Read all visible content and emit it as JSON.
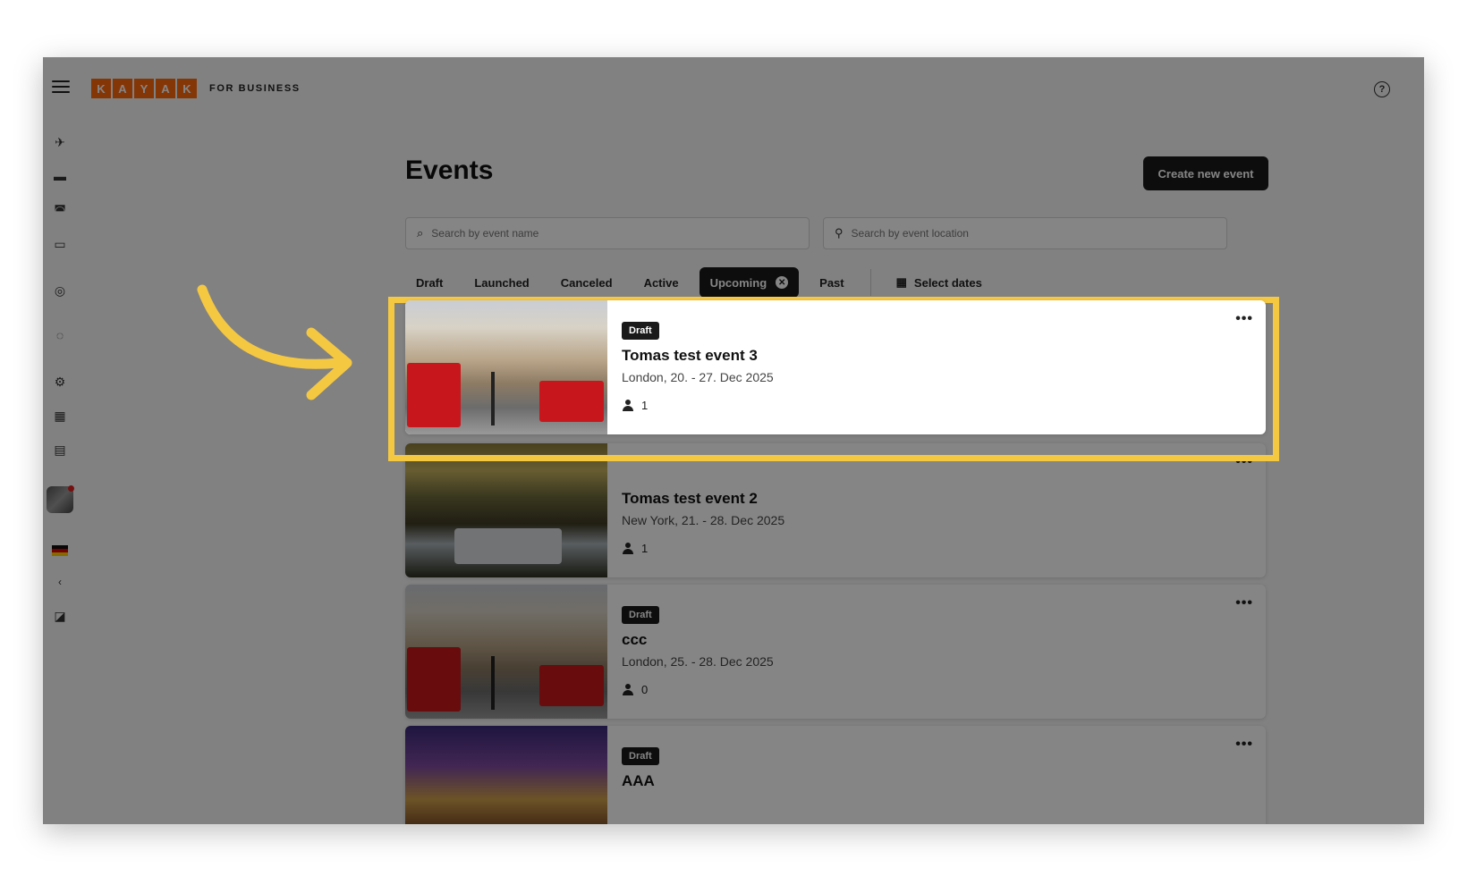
{
  "app": {
    "logo_letters": [
      "K",
      "A",
      "Y",
      "A",
      "K"
    ],
    "logo_sub": "FOR BUSINESS",
    "help_icon": "?"
  },
  "sidebar": {
    "icons": [
      "flight-icon",
      "hotel-icon",
      "car-icon",
      "train-icon",
      "target-icon",
      "support-icon",
      "settings-icon",
      "calendar-icon",
      "report-icon"
    ],
    "collapse_glyph": "‹"
  },
  "page": {
    "title": "Events",
    "create_button": "Create new event"
  },
  "search": {
    "name_placeholder": "Search by event name",
    "location_placeholder": "Search by event location"
  },
  "tabs": [
    {
      "label": "Draft",
      "active": false
    },
    {
      "label": "Launched",
      "active": false
    },
    {
      "label": "Canceled",
      "active": false
    },
    {
      "label": "Active",
      "active": false
    },
    {
      "label": "Upcoming",
      "active": true
    },
    {
      "label": "Past",
      "active": false
    }
  ],
  "date_filter": "Select dates",
  "events": [
    {
      "badge": "Draft",
      "title": "Tomas test event 3",
      "subtitle": "London, 20. - 27. Dec 2025",
      "people": "1"
    },
    {
      "badge": "",
      "title": "Tomas test event 2",
      "subtitle": "New York, 21. - 28. Dec 2025",
      "people": "1"
    },
    {
      "badge": "Draft",
      "title": "ccc",
      "subtitle": "London, 25. - 28. Dec 2025",
      "people": "0"
    },
    {
      "badge": "Draft",
      "title": "AAA",
      "subtitle": "",
      "people": ""
    }
  ],
  "colors": {
    "brand": "#ff690f",
    "highlight": "#f5c842",
    "dark": "#1a1a1a"
  }
}
